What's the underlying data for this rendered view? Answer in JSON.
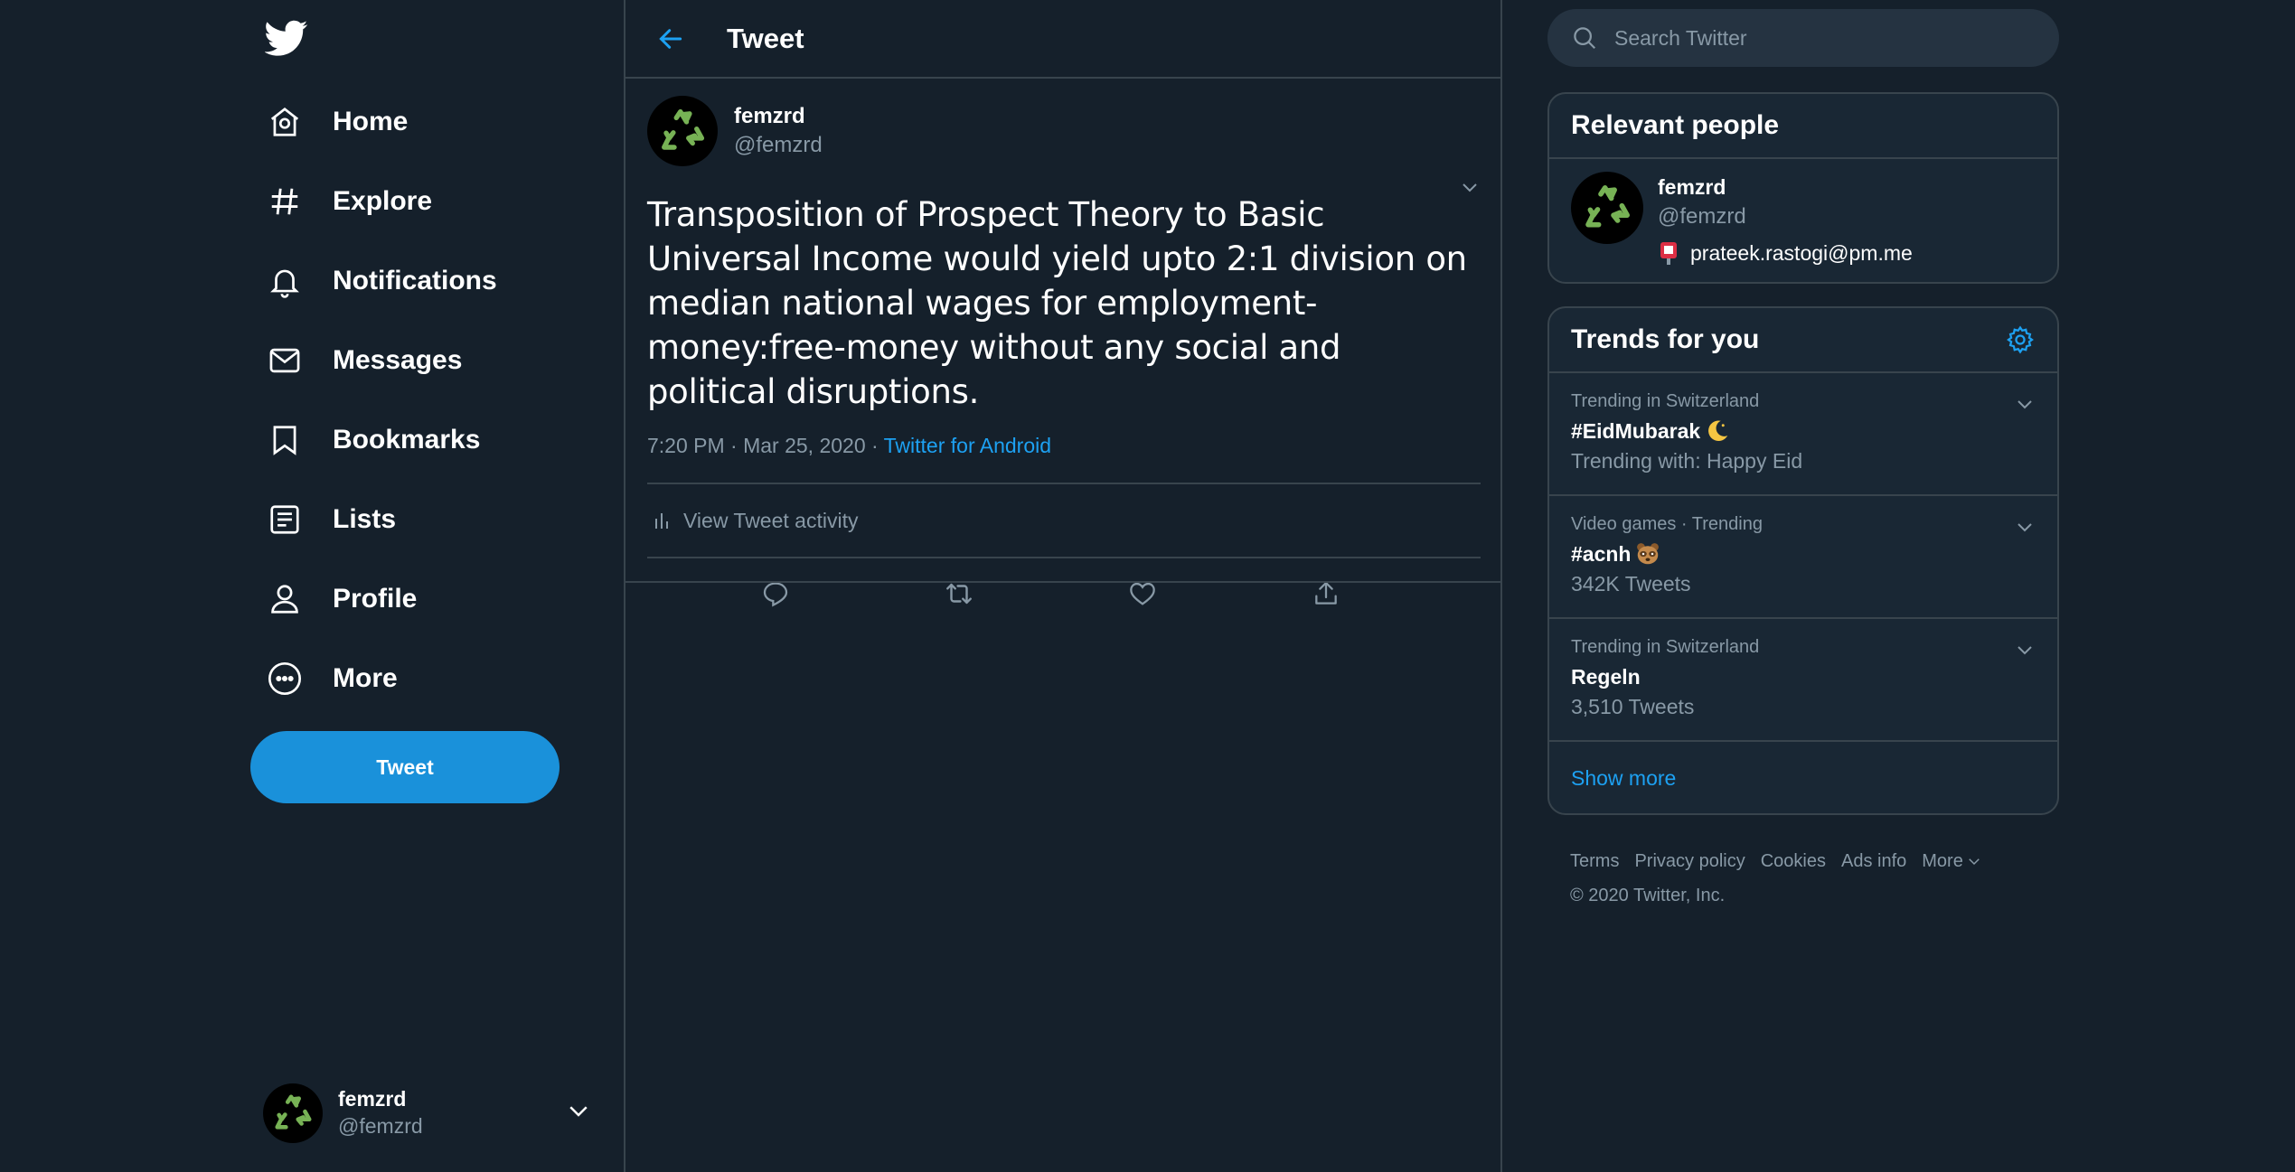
{
  "colors": {
    "background": "#15202b",
    "card": "#192734",
    "border": "#38444d",
    "accent": "#1da1f2",
    "button": "#1a91da",
    "muted": "#8899a6"
  },
  "nav": {
    "logo_icon": "twitter-bird-icon",
    "items": [
      {
        "label": "Home",
        "icon": "home-icon"
      },
      {
        "label": "Explore",
        "icon": "hashtag-icon"
      },
      {
        "label": "Notifications",
        "icon": "bell-icon"
      },
      {
        "label": "Messages",
        "icon": "envelope-icon"
      },
      {
        "label": "Bookmarks",
        "icon": "bookmark-icon"
      },
      {
        "label": "Lists",
        "icon": "list-icon"
      },
      {
        "label": "Profile",
        "icon": "person-icon"
      },
      {
        "label": "More",
        "icon": "more-circle-icon"
      }
    ],
    "tweet_button": "Tweet",
    "account": {
      "name": "femzrd",
      "handle": "@femzrd"
    }
  },
  "header": {
    "title": "Tweet"
  },
  "tweet": {
    "author_name": "femzrd",
    "author_handle": "@femzrd",
    "text": "Transposition of Prospect Theory to Basic Universal Income would yield upto 2:1 division on median national wages for employment-money:free-money without any social and political disruptions.",
    "timestamp": "7:20 PM · Mar 25, 2020 · ",
    "source": "Twitter for Android",
    "activity_label": "View Tweet activity"
  },
  "search": {
    "placeholder": "Search Twitter"
  },
  "relevant_people": {
    "title": "Relevant people",
    "name": "femzrd",
    "handle": "@femzrd",
    "bio": "prateek.rastogi@pm.me"
  },
  "trends": {
    "title": "Trends for you",
    "items": [
      {
        "context": "Trending in Switzerland",
        "name": "#EidMubarak",
        "subtitle": "Trending with: Happy Eid"
      },
      {
        "context": "Video games · Trending",
        "name": "#acnh",
        "subtitle": "342K Tweets"
      },
      {
        "context": "Trending in Switzerland",
        "name": "Regeln",
        "subtitle": "3,510 Tweets"
      }
    ],
    "show_more": "Show more"
  },
  "footer": {
    "links": [
      "Terms",
      "Privacy policy",
      "Cookies",
      "Ads info",
      "More"
    ],
    "copyright": "© 2020 Twitter, Inc."
  }
}
